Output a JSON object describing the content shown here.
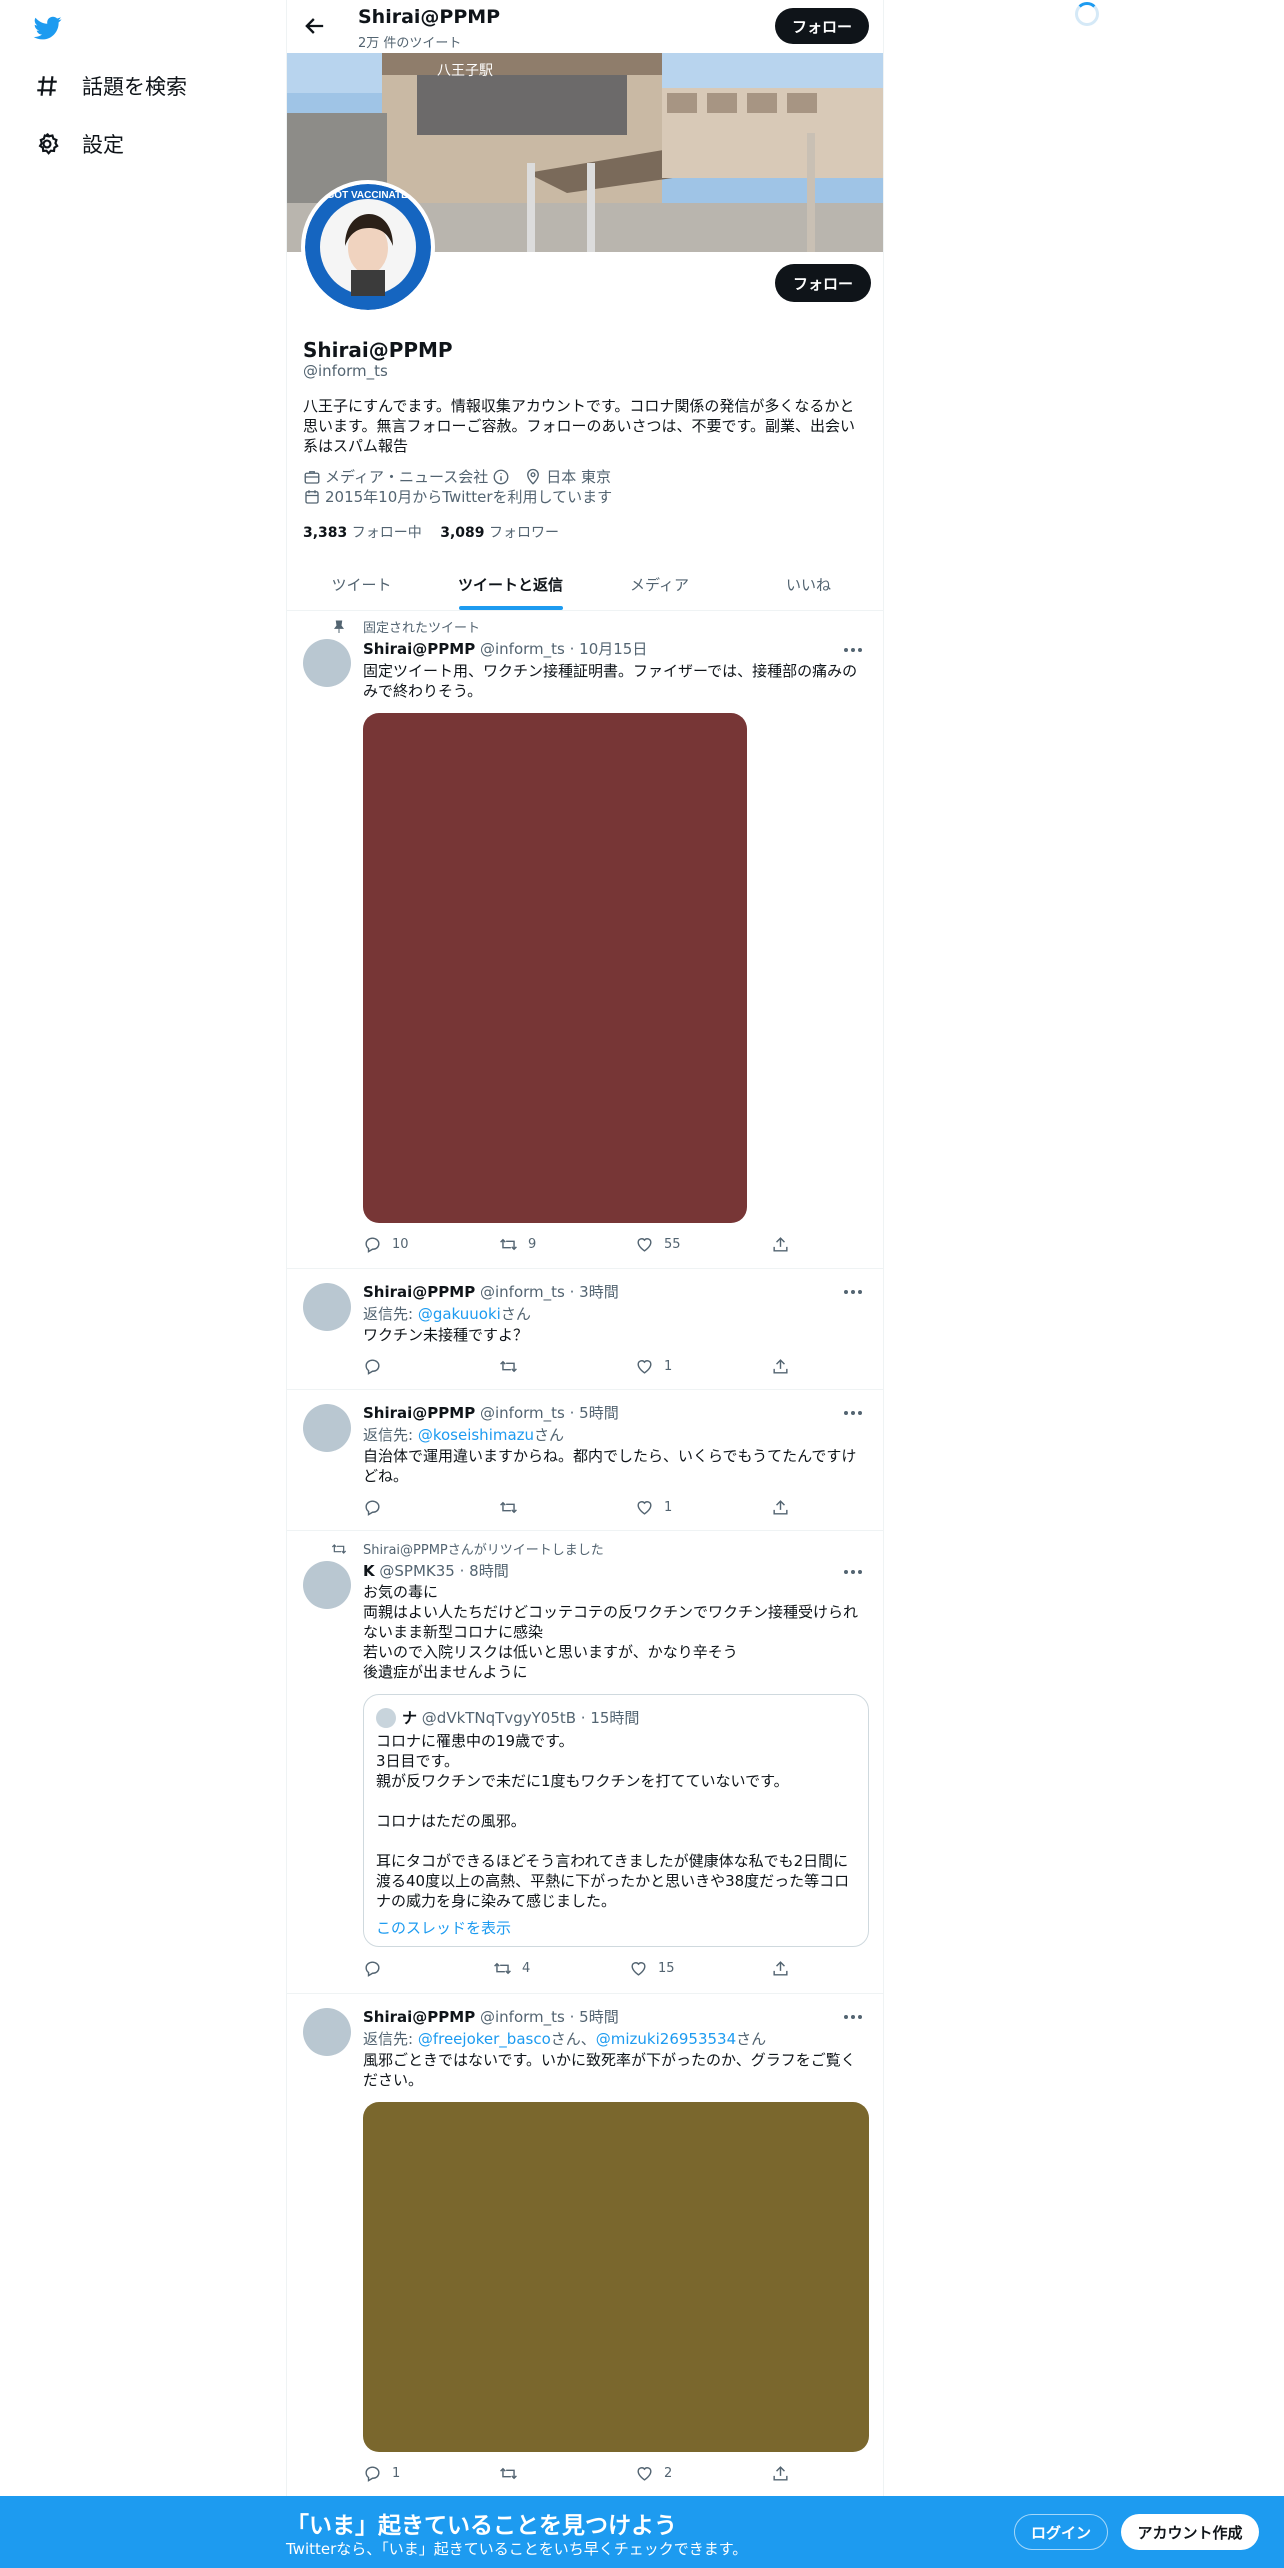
{
  "nav": {
    "explore": "話題を検索",
    "settings": "設定"
  },
  "header": {
    "name": "Shirai@PPMP",
    "tweet_count": "2万 件のツイート",
    "follow": "フォロー"
  },
  "profile": {
    "follow": "フォロー",
    "name": "Shirai@PPMP",
    "handle": "@inform_ts",
    "bio": "八王子にすんでます。情報収集アカウントです。コロナ関係の発信が多くなるかと思います。無言フォローご容赦。フォローのあいさつは、不要です。副業、出会い系はスパム報告",
    "category": "メディア・ニュース会社",
    "location": "日本 東京",
    "joined": "2015年10月からTwitterを利用しています",
    "following_count": "3,383",
    "following_label": "フォロー中",
    "followers_count": "3,089",
    "followers_label": "フォロワー",
    "avatar_text": "I GOT VACCINATED"
  },
  "tabs": [
    "ツイート",
    "ツイートと返信",
    "メディア",
    "いいね"
  ],
  "tweets": [
    {
      "context": "固定されたツイート",
      "name": "Shirai@PPMP",
      "handle": "@inform_ts",
      "time": "10月15日",
      "text": "固定ツイート用、ワクチン接種証明書。ファイザーでは、接種部の痛みのみで終わりそう。",
      "replies": "10",
      "retweets": "9",
      "likes": "55",
      "media_color": "#773636"
    },
    {
      "name": "Shirai@PPMP",
      "handle": "@inform_ts",
      "time": "3時間",
      "reply_prefix": "返信先: ",
      "reply_to": "@gakuuoki",
      "reply_suffix": "さん",
      "text": "ワクチン未接種ですよ？",
      "replies": "",
      "retweets": "",
      "likes": "1"
    },
    {
      "name": "Shirai@PPMP",
      "handle": "@inform_ts",
      "time": "5時間",
      "reply_prefix": "返信先: ",
      "reply_to": "@koseishimazu",
      "reply_suffix": "さん",
      "text": "自治体で運用違いますからね。都内でしたら、いくらでもうてたんですけどね。",
      "replies": "",
      "retweets": "",
      "likes": "1"
    },
    {
      "context": "Shirai@PPMPさんがリツイートしました",
      "name": "K",
      "handle": "@SPMK35",
      "time": "8時間",
      "text": "お気の毒に\n両親はよい人たちだけどコッテコテの反ワクチンでワクチン接種受けられないまま新型コロナに感染\n若いので入院リスクは低いと思いますが、かなり辛そう\n後遺症が出ませんように",
      "replies": "",
      "retweets": "4",
      "likes": "15",
      "quote": {
        "name": "ナ",
        "handle": "@dVkTNqTvgyY05tB",
        "time": "15時間",
        "text": "コロナに罹患中の19歳です。\n3日目です。\n親が反ワクチンで未だに1度もワクチンを打てていないです。\n\nコロナはただの風邪。\n\n耳にタコができるほどそう言われてきましたが健康体な私でも2日間に渡る40度以上の高熱、平熱に下がったかと思いきや38度だった等コロナの威力を身に染みて感じました。",
        "thread_link": "このスレッドを表示"
      }
    },
    {
      "name": "Shirai@PPMP",
      "handle": "@inform_ts",
      "time": "5時間",
      "reply_prefix": "返信先: ",
      "reply_to": "@freejoker_basco",
      "reply_mid": "さん、",
      "reply_to2": "@mizuki26953534",
      "reply_suffix": "さん",
      "text": "風邪ごときではないです。いかに致死率が下がったのか、グラフをご覧ください。",
      "replies": "1",
      "retweets": "",
      "likes": "2",
      "media_color": "#7a672d"
    }
  ],
  "bottom": {
    "title": "「いま」起きていることを見つけよう",
    "subtitle": "Twitterなら、「いま」起きていることをいち早くチェックできます。",
    "login": "ログイン",
    "signup": "アカウント作成"
  }
}
